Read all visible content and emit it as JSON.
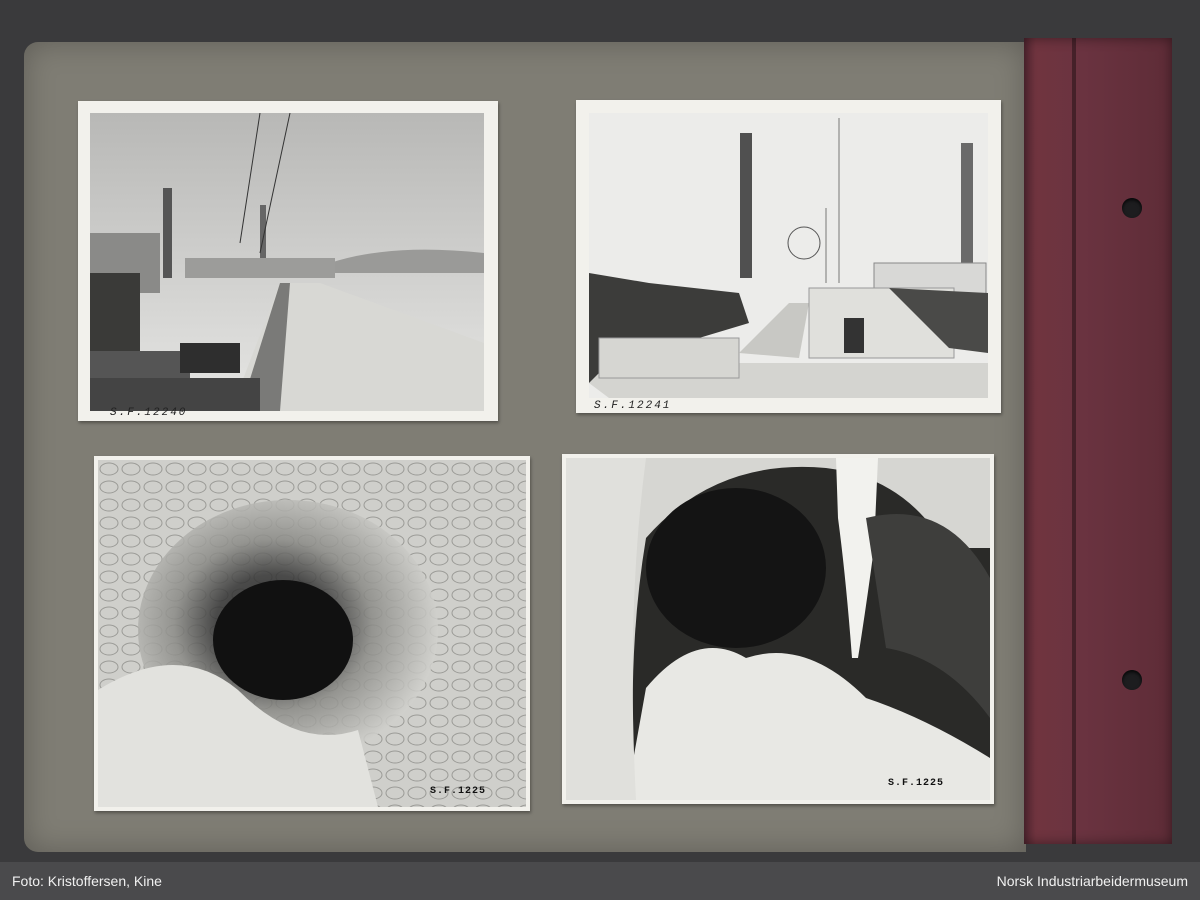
{
  "photos": {
    "top_left": {
      "caption": "S.F.12240",
      "subject": "factory-street-scene"
    },
    "top_right": {
      "caption": "S.F.12241",
      "subject": "chimneys-and-stairway-monument"
    },
    "bottom_left": {
      "subject": "cave-tunnel-opening"
    },
    "bottom_right": {
      "subject": "cave-interior-with-stalactite"
    }
  },
  "footer": {
    "credit": "Foto: Kristoffersen, Kine",
    "institution": "Norsk Industriarbeidermuseum"
  }
}
